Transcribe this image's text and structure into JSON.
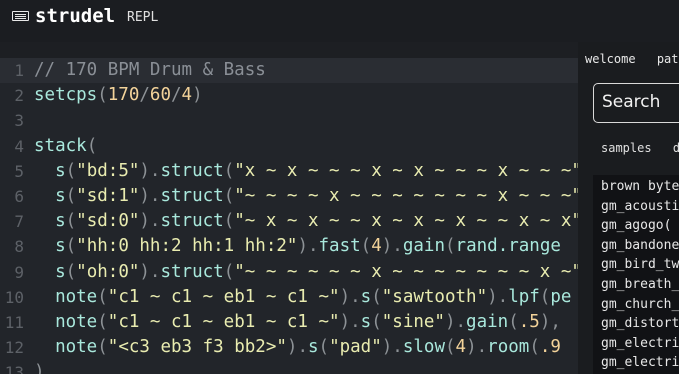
{
  "header": {
    "title": "strudel",
    "subtitle": "REPL",
    "logo_icon": "terminal-icon"
  },
  "editor": {
    "lines": [
      {
        "num": "1",
        "tokens": [
          {
            "t": "// 170 BPM Drum & Bass",
            "c": "comment"
          }
        ],
        "active": true
      },
      {
        "num": "2",
        "tokens": [
          {
            "t": "setcps",
            "c": "func"
          },
          {
            "t": "(",
            "c": "punct"
          },
          {
            "t": "170",
            "c": "num"
          },
          {
            "t": "/",
            "c": "punct"
          },
          {
            "t": "60",
            "c": "num"
          },
          {
            "t": "/",
            "c": "punct"
          },
          {
            "t": "4",
            "c": "num"
          },
          {
            "t": ")",
            "c": "punct"
          }
        ]
      },
      {
        "num": "3",
        "tokens": []
      },
      {
        "num": "4",
        "tokens": [
          {
            "t": "stack",
            "c": "func"
          },
          {
            "t": "(",
            "c": "punct"
          }
        ]
      },
      {
        "num": "5",
        "tokens": [
          {
            "t": "  ",
            "c": "plain"
          },
          {
            "t": "s",
            "c": "func"
          },
          {
            "t": "(",
            "c": "punct"
          },
          {
            "t": "\"bd:5\"",
            "c": "str"
          },
          {
            "t": ").",
            "c": "punct"
          },
          {
            "t": "struct",
            "c": "func"
          },
          {
            "t": "(",
            "c": "punct"
          },
          {
            "t": "\"x ~ x ~ ~ ~ x ~ x ~ ~ ~ x ~ ~ ~\"",
            "c": "str"
          }
        ]
      },
      {
        "num": "6",
        "tokens": [
          {
            "t": "  ",
            "c": "plain"
          },
          {
            "t": "s",
            "c": "func"
          },
          {
            "t": "(",
            "c": "punct"
          },
          {
            "t": "\"sd:1\"",
            "c": "str"
          },
          {
            "t": ").",
            "c": "punct"
          },
          {
            "t": "struct",
            "c": "func"
          },
          {
            "t": "(",
            "c": "punct"
          },
          {
            "t": "\"~ ~ ~ ~ x ~ ~ ~ ~ ~ ~ ~ x ~ ~ ~\"",
            "c": "str"
          }
        ]
      },
      {
        "num": "7",
        "tokens": [
          {
            "t": "  ",
            "c": "plain"
          },
          {
            "t": "s",
            "c": "func"
          },
          {
            "t": "(",
            "c": "punct"
          },
          {
            "t": "\"sd:0\"",
            "c": "str"
          },
          {
            "t": ").",
            "c": "punct"
          },
          {
            "t": "struct",
            "c": "func"
          },
          {
            "t": "(",
            "c": "punct"
          },
          {
            "t": "\"~ x ~ x ~ ~ x ~ x ~ x ~ ~ x ~ x\"",
            "c": "str"
          }
        ]
      },
      {
        "num": "8",
        "tokens": [
          {
            "t": "  ",
            "c": "plain"
          },
          {
            "t": "s",
            "c": "func"
          },
          {
            "t": "(",
            "c": "punct"
          },
          {
            "t": "\"hh:0 hh:2 hh:1 hh:2\"",
            "c": "str"
          },
          {
            "t": ").",
            "c": "punct"
          },
          {
            "t": "fast",
            "c": "func"
          },
          {
            "t": "(",
            "c": "punct"
          },
          {
            "t": "4",
            "c": "num"
          },
          {
            "t": ").",
            "c": "punct"
          },
          {
            "t": "gain",
            "c": "func"
          },
          {
            "t": "(",
            "c": "punct"
          },
          {
            "t": "rand.range",
            "c": "func"
          }
        ]
      },
      {
        "num": "9",
        "tokens": [
          {
            "t": "  ",
            "c": "plain"
          },
          {
            "t": "s",
            "c": "func"
          },
          {
            "t": "(",
            "c": "punct"
          },
          {
            "t": "\"oh:0\"",
            "c": "str"
          },
          {
            "t": ").",
            "c": "punct"
          },
          {
            "t": "struct",
            "c": "func"
          },
          {
            "t": "(",
            "c": "punct"
          },
          {
            "t": "\"~ ~ ~ ~ ~ ~ x ~ ~ ~ ~ ~ ~ ~ x ~\"",
            "c": "str"
          }
        ]
      },
      {
        "num": "10",
        "tokens": [
          {
            "t": "  ",
            "c": "plain"
          },
          {
            "t": "note",
            "c": "func"
          },
          {
            "t": "(",
            "c": "punct"
          },
          {
            "t": "\"c1 ~ c1 ~ eb1 ~ c1 ~\"",
            "c": "str"
          },
          {
            "t": ").",
            "c": "punct"
          },
          {
            "t": "s",
            "c": "func"
          },
          {
            "t": "(",
            "c": "punct"
          },
          {
            "t": "\"sawtooth\"",
            "c": "str"
          },
          {
            "t": ").",
            "c": "punct"
          },
          {
            "t": "lpf",
            "c": "func"
          },
          {
            "t": "(",
            "c": "punct"
          },
          {
            "t": "pe",
            "c": "func"
          }
        ]
      },
      {
        "num": "11",
        "tokens": [
          {
            "t": "  ",
            "c": "plain"
          },
          {
            "t": "note",
            "c": "func"
          },
          {
            "t": "(",
            "c": "punct"
          },
          {
            "t": "\"c1 ~ c1 ~ eb1 ~ c1 ~\"",
            "c": "str"
          },
          {
            "t": ").",
            "c": "punct"
          },
          {
            "t": "s",
            "c": "func"
          },
          {
            "t": "(",
            "c": "punct"
          },
          {
            "t": "\"sine\"",
            "c": "str"
          },
          {
            "t": ").",
            "c": "punct"
          },
          {
            "t": "gain",
            "c": "func"
          },
          {
            "t": "(",
            "c": "punct"
          },
          {
            "t": ".5",
            "c": "num"
          },
          {
            "t": "),",
            "c": "punct"
          }
        ]
      },
      {
        "num": "12",
        "tokens": [
          {
            "t": "  ",
            "c": "plain"
          },
          {
            "t": "note",
            "c": "func"
          },
          {
            "t": "(",
            "c": "punct"
          },
          {
            "t": "\"<c3 eb3 f3 bb2>\"",
            "c": "str"
          },
          {
            "t": ").",
            "c": "punct"
          },
          {
            "t": "s",
            "c": "func"
          },
          {
            "t": "(",
            "c": "punct"
          },
          {
            "t": "\"pad\"",
            "c": "str"
          },
          {
            "t": ").",
            "c": "punct"
          },
          {
            "t": "slow",
            "c": "func"
          },
          {
            "t": "(",
            "c": "punct"
          },
          {
            "t": "4",
            "c": "num"
          },
          {
            "t": ").",
            "c": "punct"
          },
          {
            "t": "room",
            "c": "func"
          },
          {
            "t": "(",
            "c": "punct"
          },
          {
            "t": ".9",
            "c": "num"
          }
        ]
      },
      {
        "num": "13",
        "tokens": [
          {
            "t": ")",
            "c": "punct"
          }
        ]
      }
    ]
  },
  "side": {
    "tabs": [
      "welcome",
      "patt"
    ],
    "search_placeholder": "Search",
    "subtabs": [
      "samples",
      "dr"
    ],
    "samples": [
      "brown byte",
      "gm_acousti",
      "gm_agogo(",
      "gm_bandone",
      "gm_bird_tw",
      "gm_breath_",
      "gm_church_",
      "gm_distort",
      "gm_electri",
      "gm_electri"
    ]
  },
  "colors": {
    "comment": "#8a8f96",
    "func": "#a9e8dc",
    "str": "#e9ecb0",
    "num": "#f3d39a",
    "punct": "#8d9296"
  }
}
